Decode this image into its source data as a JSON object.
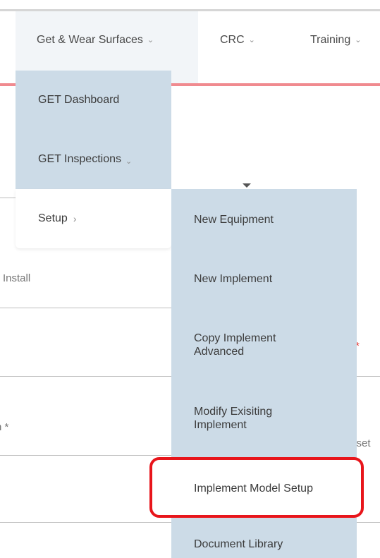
{
  "nav": {
    "items": [
      {
        "label": "Get & Wear Surfaces",
        "chevron": "⌄"
      },
      {
        "label": "CRC",
        "chevron": "⌄"
      },
      {
        "label": "Training",
        "chevron": "⌄"
      }
    ]
  },
  "background_form": {
    "install_label": "Install",
    "right_label_1": "*",
    "left_label_2": "n *",
    "right_label_2": "sset"
  },
  "menu_level1": {
    "items": [
      {
        "label": "GET Dashboard"
      },
      {
        "label": "GET Inspections",
        "chevron": "⌄"
      },
      {
        "label": "Setup",
        "chevron": "›"
      }
    ]
  },
  "menu_level2": {
    "items": [
      {
        "label": "New Equipment"
      },
      {
        "label": "New Implement"
      },
      {
        "label": "Copy Implement Advanced"
      },
      {
        "label": "Modify Exisiting Implement"
      },
      {
        "label": "Implement Model Setup"
      },
      {
        "label": "Document Library"
      }
    ]
  },
  "colors": {
    "menu_blue": "#ccdbe7",
    "accent_red": "#e8151b",
    "nav_underline": "#f08a8f"
  }
}
